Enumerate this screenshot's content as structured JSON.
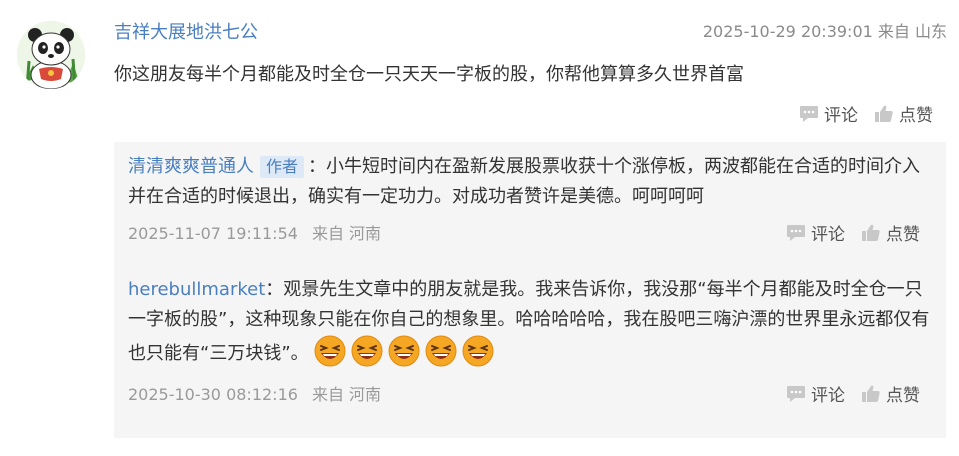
{
  "comment": {
    "author": "吉祥大展地洪七公",
    "timestamp": "2025-10-29 20:39:01",
    "location": "来自 山东",
    "text": "你这朋友每半个月都能及时全仓一只天天一字板的股，你帮他算算多久世界首富",
    "comment_label": "评论",
    "like_label": "点赞"
  },
  "replies": [
    {
      "user": "清清爽爽普通人",
      "badge": "作者",
      "separator": "：",
      "text": "小牛短时间内在盈新发展股票收获十个涨停板，两波都能在合适的时间介入并在合适的时候退出，确实有一定功力。对成功者赞许是美德。呵呵呵呵",
      "timestamp": "2025-11-07 19:11:54",
      "location": "来自 河南",
      "comment_label": "评论",
      "like_label": "点赞"
    },
    {
      "user": "herebullmarket",
      "separator": "：",
      "text": "观景先生文章中的朋友就是我。我来告诉你，我没那“每半个月都能及时全仓一只一字板的股”，这种现象只能在你自己的想象里。哈哈哈哈哈，我在股吧三嗨沪漂的世界里永远都仅有也只能有“三万块钱”。",
      "emoji_count": 5,
      "emoji_icon": "laughing-face-icon",
      "timestamp": "2025-10-30 08:12:16",
      "location": "来自 河南",
      "comment_label": "评论",
      "like_label": "点赞"
    }
  ],
  "colors": {
    "link": "#4a7fbf",
    "badge_bg": "#dde9f7",
    "reply_bg": "#f5f5f5",
    "meta": "#8a8a8a",
    "emoji": "#f5a623"
  }
}
